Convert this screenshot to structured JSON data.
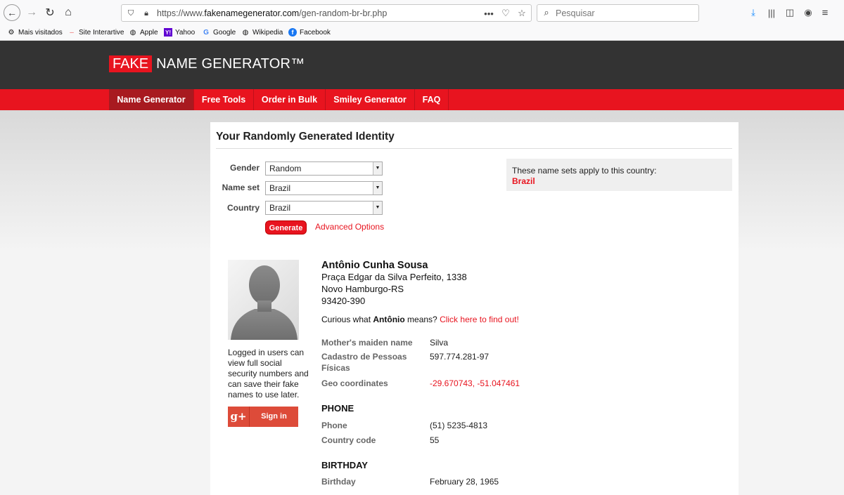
{
  "browser": {
    "url_prefix": "https://www.",
    "url_domain": "fakenamegenerator.com",
    "url_path": "/gen-random-br-br.php",
    "search_placeholder": "Pesquisar",
    "bookmarks": [
      {
        "label": "Mais visitados",
        "icon": "gear-icon"
      },
      {
        "label": "Site Interartive",
        "icon": "dash-icon"
      },
      {
        "label": "Apple",
        "icon": "globe-icon"
      },
      {
        "label": "Yahoo",
        "icon": "yahoo-icon"
      },
      {
        "label": "Google",
        "icon": "google-icon"
      },
      {
        "label": "Wikipedia",
        "icon": "globe-icon"
      },
      {
        "label": "Facebook",
        "icon": "facebook-icon"
      }
    ]
  },
  "site": {
    "logo_fake": "FAKE",
    "logo_rest": "NAME GENERATOR™",
    "nav": [
      "Name Generator",
      "Free Tools",
      "Order in Bulk",
      "Smiley Generator",
      "FAQ"
    ],
    "accent": "#e8141f"
  },
  "form": {
    "heading": "Your Randomly Generated Identity",
    "gender_label": "Gender",
    "gender_value": "Random",
    "nameset_label": "Name set",
    "nameset_value": "Brazil",
    "country_label": "Country",
    "country_value": "Brazil",
    "generate_label": "Generate",
    "advanced_label": "Advanced Options",
    "nameset_note": "These name sets apply to this country:",
    "nameset_country": "Brazil"
  },
  "sidebar": {
    "login_note": "Logged in users can view full social security numbers and can save their fake names to use later.",
    "gplus_label": "g+",
    "signin_label": "Sign in"
  },
  "identity": {
    "name": "Antônio Cunha Sousa",
    "address_line1": "Praça Edgar da Silva Perfeito, 1338",
    "address_line2": "Novo Hamburgo-RS",
    "address_line3": "93420-390",
    "curious_pre": "Curious what ",
    "first_name": "Antônio",
    "curious_post": " means? ",
    "curious_link": "Click here to find out!",
    "details": [
      {
        "label": "Mother's maiden name",
        "value": "Silva"
      },
      {
        "label": "Cadastro de Pessoas Físicas",
        "value": "597.774.281-97"
      },
      {
        "label": "Geo coordinates",
        "value": "-29.670743, -51.047461"
      }
    ],
    "phone_heading": "PHONE",
    "phone_label": "Phone",
    "phone_value": "(51) 5235-4813",
    "country_code_label": "Country code",
    "country_code_value": "55",
    "birthday_heading": "BIRTHDAY",
    "birthday_label": "Birthday",
    "birthday_value": "February 28, 1965"
  }
}
